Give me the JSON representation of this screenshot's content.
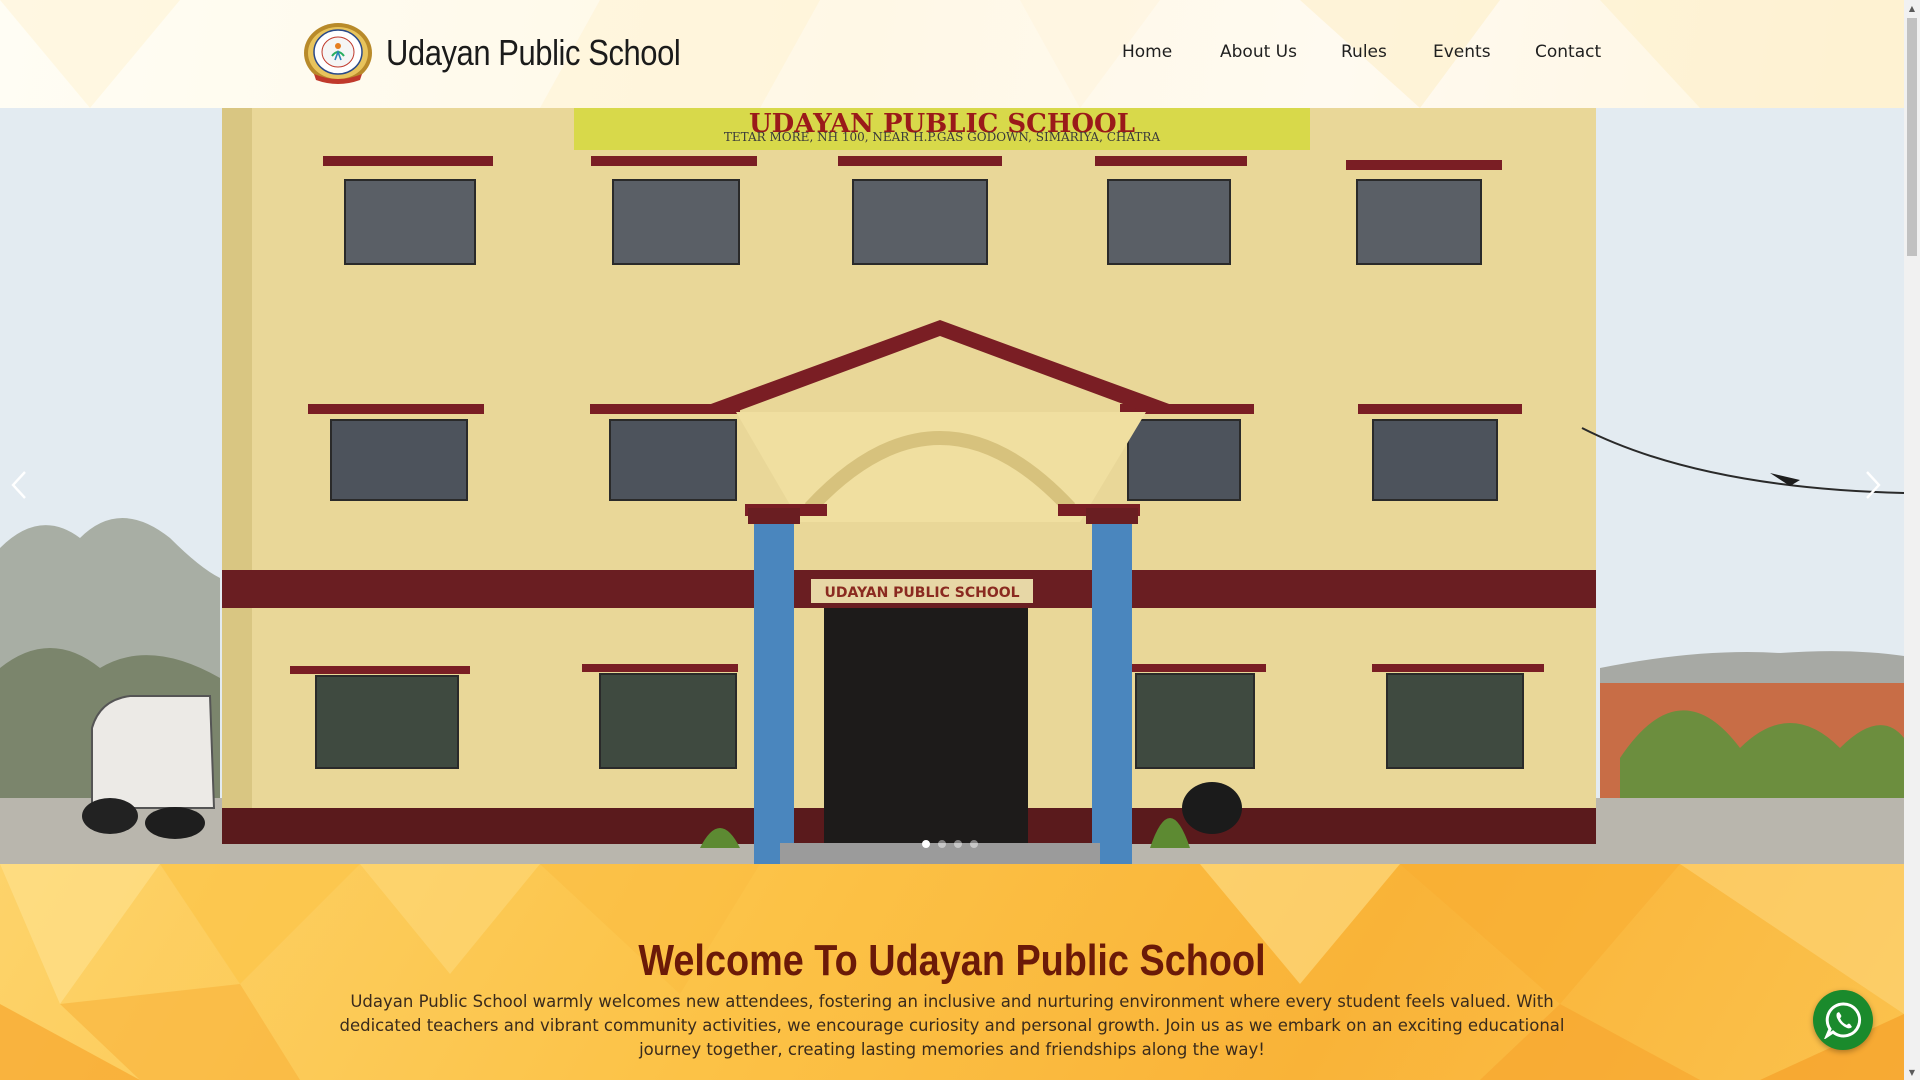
{
  "header": {
    "school_name": "Udayan Public School",
    "logo_icon": "school-emblem-logo",
    "nav": [
      {
        "label": "Home"
      },
      {
        "label": "About Us"
      },
      {
        "label": "Rules"
      },
      {
        "label": "Events"
      },
      {
        "label": "Contact"
      }
    ]
  },
  "hero": {
    "building_sign_top": "TETAR MORE, NH 100, NEAR H.P.GAS GODOWN, SIMARIYA, CHATRA",
    "building_sign_main": "UDAYAN PUBLIC SCHOOL",
    "entrance_sign": "UDAYAN PUBLIC SCHOOL",
    "prev_icon": "chevron-left-icon",
    "next_icon": "chevron-right-icon",
    "slide_count": 4,
    "active_slide": 1
  },
  "welcome": {
    "title": "Welcome To Udayan Public School",
    "text": "Udayan Public School warmly welcomes new attendees, fostering an inclusive and nurturing environment where every student feels valued. With dedicated teachers and vibrant community activities, we encourage curiosity and personal growth. Join us as we embark on an exciting educational journey together, creating lasting memories and friendships along the way!"
  },
  "whatsapp": {
    "icon": "whatsapp-icon"
  },
  "colors": {
    "welcome_title": "#6b1a08",
    "welcome_bg": "#fcc246",
    "whatsapp": "#1a8a2c",
    "building_wall": "#ead99a",
    "building_trim": "#6a1e22"
  }
}
